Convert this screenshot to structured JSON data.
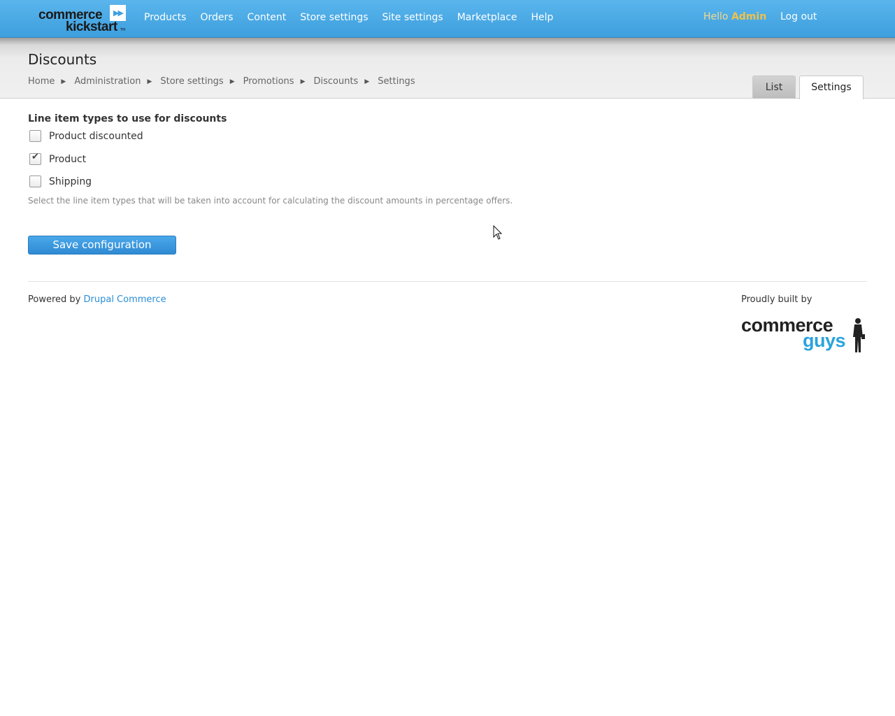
{
  "topbar": {
    "logo_line1": "commerce",
    "logo_line2": "kickstart",
    "logo_tm": "TM",
    "nav": [
      "Products",
      "Orders",
      "Content",
      "Store settings",
      "Site settings",
      "Marketplace",
      "Help"
    ],
    "hello_prefix": "Hello",
    "hello_user": "Admin",
    "logout": "Log out"
  },
  "header": {
    "title": "Discounts",
    "breadcrumb": [
      "Home",
      "Administration",
      "Store settings",
      "Promotions",
      "Discounts",
      "Settings"
    ],
    "tabs": [
      {
        "label": "List",
        "active": false
      },
      {
        "label": "Settings",
        "active": true
      }
    ]
  },
  "form": {
    "legend": "Line item types to use for discounts",
    "options": [
      {
        "label": "Product discounted",
        "checked": false
      },
      {
        "label": "Product",
        "checked": true
      },
      {
        "label": "Shipping",
        "checked": false
      }
    ],
    "description": "Select the line item types that will be taken into account for calculating the discount amounts in percentage offers.",
    "save_label": "Save configuration"
  },
  "footer": {
    "powered_prefix": "Powered by",
    "powered_link": "Drupal Commerce",
    "built_by": "Proudly built by",
    "cg_word1": "commerce",
    "cg_word2": "guys"
  },
  "colors": {
    "topbar": "#4aaae6",
    "accent": "#2a8fd6",
    "hello_user": "#f0c24a",
    "save_button": "#3a98de"
  }
}
